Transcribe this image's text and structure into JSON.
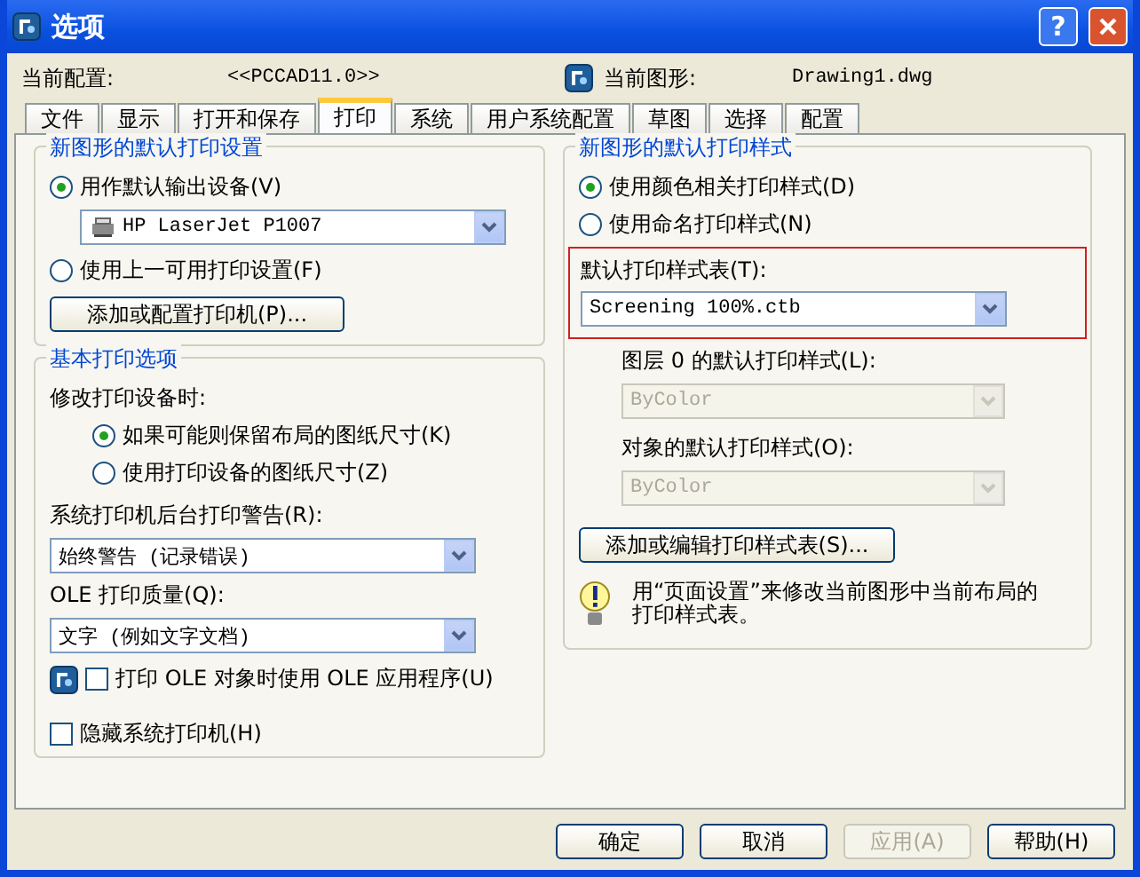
{
  "window": {
    "title": "选项",
    "help_symbol": "?"
  },
  "header": {
    "profile_label": "当前配置:",
    "profile_value": "<<PCCAD11.0>>",
    "drawing_label": "当前图形:",
    "drawing_value": "Drawing1.dwg"
  },
  "tabs": [
    {
      "label": "文件",
      "selected": false
    },
    {
      "label": "显示",
      "selected": false
    },
    {
      "label": "打开和保存",
      "selected": false
    },
    {
      "label": "打印",
      "selected": true
    },
    {
      "label": "系统",
      "selected": false
    },
    {
      "label": "用户系统配置",
      "selected": false
    },
    {
      "label": "草图",
      "selected": false
    },
    {
      "label": "选择",
      "selected": false
    },
    {
      "label": "配置",
      "selected": false
    }
  ],
  "left": {
    "device_group": {
      "title": "新图形的默认打印设置",
      "options": [
        {
          "label": "用作默认输出设备(V)",
          "selected": true
        },
        {
          "label": "使用上一可用打印设置(F)",
          "selected": false
        }
      ],
      "device_dropdown": {
        "value": "HP LaserJet P1007"
      },
      "add_printer_button": "添加或配置打印机(P)..."
    },
    "basic_group": {
      "title": "基本打印选项",
      "change_label": "修改打印设备时:",
      "paper_options": [
        {
          "label": "如果可能则保留布局的图纸尺寸(K)",
          "selected": true
        },
        {
          "label": "使用打印设备的图纸尺寸(Z)",
          "selected": false
        }
      ],
      "spool_label": "系统打印机后台打印警告(R):",
      "spool_dropdown": {
        "value": "始终警告 (记录错误)"
      },
      "ole_label": "OLE 打印质量(Q):",
      "ole_dropdown": {
        "value": "文字 (例如文字文档)"
      },
      "checkboxes": [
        {
          "label": "打印 OLE 对象时使用 OLE 应用程序(U)",
          "checked": false,
          "icon": true
        },
        {
          "label": "隐藏系统打印机(H)",
          "checked": false,
          "icon": false
        }
      ]
    }
  },
  "right": {
    "style_group": {
      "title": "新图形的默认打印样式",
      "options": [
        {
          "label": "使用颜色相关打印样式(D)",
          "selected": true
        },
        {
          "label": "使用命名打印样式(N)",
          "selected": false
        }
      ],
      "table_label": "默认打印样式表(T):",
      "table_dropdown": {
        "value": "Screening 100%.ctb",
        "disabled": false,
        "highlighted": true
      },
      "layer_label": "图层 0 的默认打印样式(L):",
      "layer_dropdown": {
        "value": "ByColor",
        "disabled": true
      },
      "object_label": "对象的默认打印样式(O):",
      "object_dropdown": {
        "value": "ByColor",
        "disabled": true
      },
      "edit_button": "添加或编辑打印样式表(S)...",
      "tip": "用“页面设置”来修改当前图形中当前布局的打印样式表。"
    }
  },
  "buttons": [
    {
      "label": "确定",
      "disabled": false
    },
    {
      "label": "取消",
      "disabled": false
    },
    {
      "label": "应用(A)",
      "disabled": true
    },
    {
      "label": "帮助(H)",
      "disabled": false
    }
  ]
}
